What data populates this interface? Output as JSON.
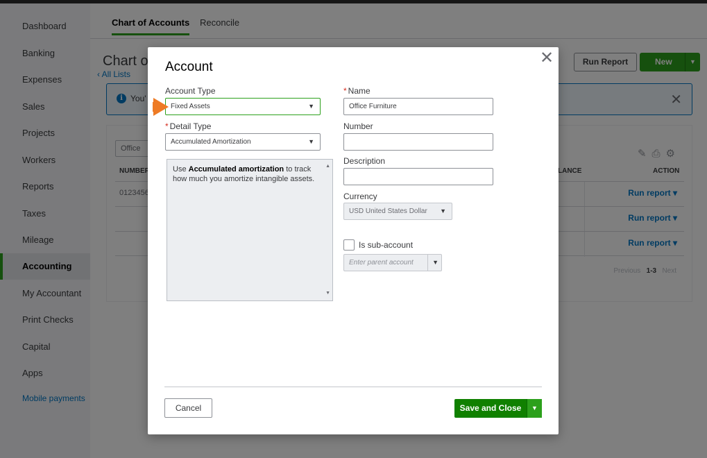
{
  "sidebar": {
    "items": [
      {
        "label": "Dashboard"
      },
      {
        "label": "Banking"
      },
      {
        "label": "Expenses"
      },
      {
        "label": "Sales"
      },
      {
        "label": "Projects"
      },
      {
        "label": "Workers"
      },
      {
        "label": "Reports"
      },
      {
        "label": "Taxes"
      },
      {
        "label": "Mileage"
      },
      {
        "label": "Accounting"
      },
      {
        "label": "My Accountant"
      },
      {
        "label": "Print Checks"
      },
      {
        "label": "Capital"
      },
      {
        "label": "Apps"
      },
      {
        "label": "Mobile payments"
      }
    ]
  },
  "tabs": [
    {
      "label": "Chart of Accounts"
    },
    {
      "label": "Reconcile"
    }
  ],
  "page": {
    "title": "Chart o",
    "all_lists": "All Lists",
    "run_report_label": "Run Report",
    "new_label": "New",
    "banner_text": "You'",
    "filter_value": "Office"
  },
  "table": {
    "col_number": "NUMBER",
    "col_balance": "LANCE",
    "col_action": "ACTION",
    "rows": [
      {
        "number": "0123456",
        "action": "Run report"
      },
      {
        "number": "",
        "action": "Run report"
      },
      {
        "number": "",
        "action": "Run report"
      }
    ],
    "pager_previous": "Previous",
    "pager_range": "1-3",
    "pager_next": "Next"
  },
  "modal": {
    "title": "Account",
    "account_type_label": "Account Type",
    "account_type_value": "Fixed Assets",
    "detail_type_label": "Detail Type",
    "detail_type_value": "Accumulated Amortization",
    "description_pre": "Use ",
    "description_bold": "Accumulated amortization",
    "description_post": " to track how much you amortize intangible assets.",
    "name_label": "Name",
    "name_value": "Office Furniture",
    "number_label": "Number",
    "number_value": "",
    "desc_label": "Description",
    "desc_value": "",
    "currency_label": "Currency",
    "currency_value": "USD United States Dollar",
    "subaccount_label": "Is sub-account",
    "parent_placeholder": "Enter parent account",
    "cancel_label": "Cancel",
    "save_label": "Save and Close"
  },
  "colors": {
    "accent_green": "#2ca01c",
    "save_green": "#108000",
    "link_blue": "#0077c5",
    "arrow_orange": "#ee7b25",
    "required_red": "#d52b1e"
  }
}
